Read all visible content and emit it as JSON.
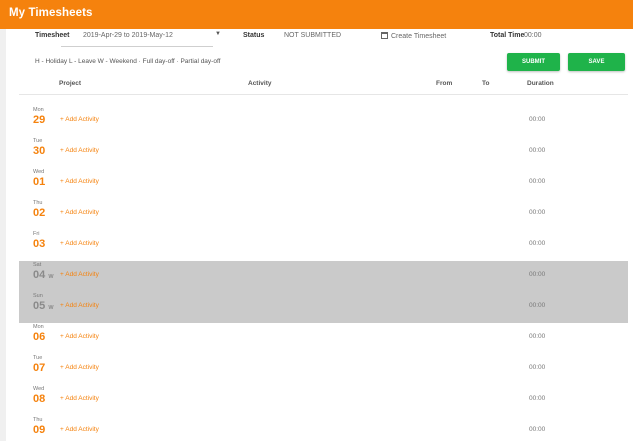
{
  "header": {
    "title": "My Timesheets"
  },
  "timesheet": {
    "label": "Timesheet",
    "period": "2019-Apr-29 to 2019-May-12",
    "status_label": "Status",
    "status_value": "NOT SUBMITTED",
    "create_label": "Create Timesheet",
    "total_label": "Total Time",
    "total_value": "00:00"
  },
  "legend": "H - Holiday   L - Leave   W - Weekend   · Full day-off   · Partial day-off",
  "buttons": {
    "submit": "SUBMIT",
    "save": "SAVE"
  },
  "columns": {
    "project": "Project",
    "activity": "Activity",
    "from": "From",
    "to": "To",
    "duration": "Duration"
  },
  "rows": [
    {
      "dname": "Mon",
      "dnum": "29",
      "tag": "",
      "add": "+ Add Activity",
      "dur": "00:00"
    },
    {
      "dname": "Tue",
      "dnum": "30",
      "tag": "",
      "add": "+ Add Activity",
      "dur": "00:00"
    },
    {
      "dname": "Wed",
      "dnum": "01",
      "tag": "",
      "add": "+ Add Activity",
      "dur": "00:00"
    },
    {
      "dname": "Thu",
      "dnum": "02",
      "tag": "",
      "add": "+ Add Activity",
      "dur": "00:00"
    },
    {
      "dname": "Fri",
      "dnum": "03",
      "tag": "",
      "add": "+ Add Activity",
      "dur": "00:00"
    },
    {
      "dname": "Sat",
      "dnum": "04",
      "tag": "W",
      "add": "+ Add Activity",
      "dur": "00:00"
    },
    {
      "dname": "Sun",
      "dnum": "05",
      "tag": "W",
      "add": "+ Add Activity",
      "dur": "00:00"
    },
    {
      "dname": "Mon",
      "dnum": "06",
      "tag": "",
      "add": "+ Add Activity",
      "dur": "00:00"
    },
    {
      "dname": "Tue",
      "dnum": "07",
      "tag": "",
      "add": "+ Add Activity",
      "dur": "00:00"
    },
    {
      "dname": "Wed",
      "dnum": "08",
      "tag": "",
      "add": "+ Add Activity",
      "dur": "00:00"
    },
    {
      "dname": "Thu",
      "dnum": "09",
      "tag": "",
      "add": "+ Add Activity",
      "dur": "00:00"
    }
  ]
}
